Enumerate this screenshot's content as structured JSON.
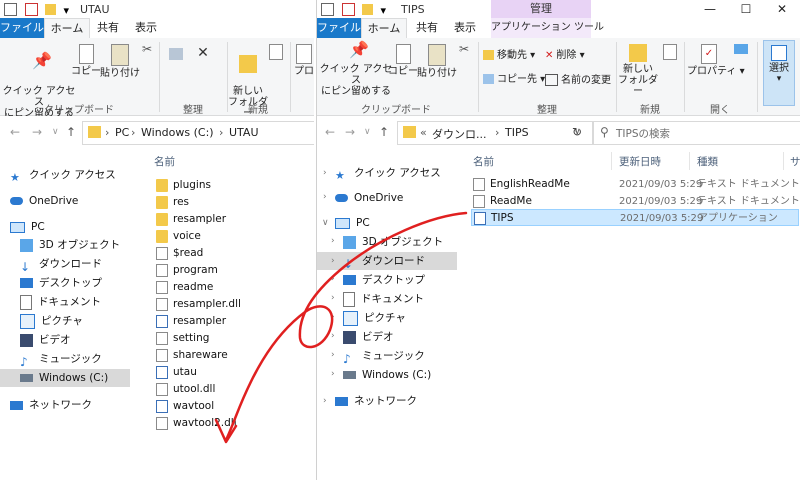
{
  "left_window": {
    "title": "UTAU",
    "tabs": [
      "ファイル",
      "ホーム",
      "共有",
      "表示"
    ],
    "ribbon": {
      "pin_label": "クイック アクセス\nにピン留めする",
      "copy_label": "コピー",
      "paste_label": "貼り付け",
      "clipboard_group": "クリップボード",
      "organize_group": "整理",
      "new_folder_label": "新しい\nフォルダー",
      "new_group": "新規",
      "cut_label": "プロ"
    },
    "address": {
      "crumbs": [
        "PC",
        "Windows (C:)",
        "UTAU"
      ]
    },
    "nav": [
      {
        "label": "クイック アクセス",
        "icon": "star-icon"
      },
      {
        "label": "OneDrive",
        "icon": "cloud-icon"
      },
      {
        "label": "PC",
        "icon": "pc-icon"
      },
      {
        "label": "3D オブジェクト",
        "icon": "cube-icon"
      },
      {
        "label": "ダウンロード",
        "icon": "download-icon"
      },
      {
        "label": "デスクトップ",
        "icon": "desktop-icon"
      },
      {
        "label": "ドキュメント",
        "icon": "document-icon"
      },
      {
        "label": "ピクチャ",
        "icon": "picture-icon"
      },
      {
        "label": "ビデオ",
        "icon": "video-icon"
      },
      {
        "label": "ミュージック",
        "icon": "music-icon"
      },
      {
        "label": "Windows (C:)",
        "icon": "drive-icon"
      },
      {
        "label": "ネットワーク",
        "icon": "network-icon"
      }
    ],
    "column_name": "名前",
    "files": [
      {
        "name": "plugins",
        "kind": "folder"
      },
      {
        "name": "res",
        "kind": "folder"
      },
      {
        "name": "resampler",
        "kind": "folder"
      },
      {
        "name": "voice",
        "kind": "folder"
      },
      {
        "name": "$read",
        "kind": "doc"
      },
      {
        "name": "program",
        "kind": "doc"
      },
      {
        "name": "readme",
        "kind": "doc"
      },
      {
        "name": "resampler.dll",
        "kind": "doc"
      },
      {
        "name": "resampler",
        "kind": "app"
      },
      {
        "name": "setting",
        "kind": "doc"
      },
      {
        "name": "shareware",
        "kind": "doc"
      },
      {
        "name": "utau",
        "kind": "app"
      },
      {
        "name": "utool.dll",
        "kind": "doc"
      },
      {
        "name": "wavtool",
        "kind": "app"
      },
      {
        "name": "wavtool2.dll",
        "kind": "doc"
      }
    ]
  },
  "right_window": {
    "title": "TIPS",
    "context_tab_header": "管理",
    "tabs": [
      "ファイル",
      "ホーム",
      "共有",
      "表示",
      "アプリケーション ツール"
    ],
    "ribbon": {
      "pin_label": "クイック アクセス\nにピン留めする",
      "copy_label": "コピー",
      "paste_label": "貼り付け",
      "clipboard_group": "クリップボード",
      "move_to": "移動先",
      "copy_to": "コピー先",
      "delete": "削除",
      "rename": "名前の変更",
      "organize_group": "整理",
      "new_folder_label": "新しい\nフォルダー",
      "new_group": "新規",
      "properties_label": "プロパティ",
      "open_group": "開く",
      "select_label": "選択"
    },
    "address": {
      "crumbs": [
        "«",
        "ダウンロ...",
        "TIPS"
      ]
    },
    "search_placeholder": "TIPSの検索",
    "nav": [
      {
        "label": "クイック アクセス",
        "icon": "star-icon"
      },
      {
        "label": "OneDrive",
        "icon": "cloud-icon"
      },
      {
        "label": "PC",
        "icon": "pc-icon"
      },
      {
        "label": "3D オブジェクト",
        "icon": "cube-icon"
      },
      {
        "label": "ダウンロード",
        "icon": "download-icon"
      },
      {
        "label": "デスクトップ",
        "icon": "desktop-icon"
      },
      {
        "label": "ドキュメント",
        "icon": "document-icon"
      },
      {
        "label": "ピクチャ",
        "icon": "picture-icon"
      },
      {
        "label": "ビデオ",
        "icon": "video-icon"
      },
      {
        "label": "ミュージック",
        "icon": "music-icon"
      },
      {
        "label": "Windows (C:)",
        "icon": "drive-icon"
      },
      {
        "label": "ネットワーク",
        "icon": "network-icon"
      }
    ],
    "columns": [
      "名前",
      "更新日時",
      "種類",
      "サ"
    ],
    "files": [
      {
        "name": "EnglishReadMe",
        "date": "2021/09/03 5:29",
        "type": "テキスト ドキュメント",
        "kind": "doc"
      },
      {
        "name": "ReadMe",
        "date": "2021/09/03 5:29",
        "type": "テキスト ドキュメント",
        "kind": "doc"
      },
      {
        "name": "TIPS",
        "date": "2021/09/03 5:29",
        "type": "アプリケーション",
        "kind": "app"
      }
    ],
    "window_controls": [
      "—",
      "☐",
      "✕"
    ]
  },
  "colors": {
    "file_tab": "#1979ca",
    "context_tab": "#e8d3f5",
    "selection": "#cce8ff",
    "annotation_stroke": "#e02020"
  }
}
